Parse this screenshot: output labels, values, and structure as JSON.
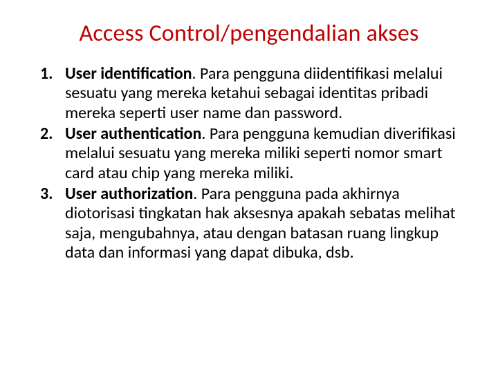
{
  "title": "Access Control/pengendalian akses",
  "items": [
    {
      "term": "User identification",
      "desc": ". Para pengguna diidentifikasi melalui sesuatu yang mereka ketahui sebagai identitas pribadi mereka seperti user name dan password."
    },
    {
      "term": "User authentication",
      "desc": ". Para pengguna kemudian diverifikasi melalui sesuatu yang mereka miliki seperti nomor smart card atau chip yang mereka miliki."
    },
    {
      "term": "User authorization",
      "desc": ". Para pengguna pada akhirnya diotorisasi tingkatan hak aksesnya apakah sebatas melihat saja, mengubahnya, atau dengan batasan ruang lingkup data dan informasi yang dapat dibuka, dsb."
    }
  ]
}
